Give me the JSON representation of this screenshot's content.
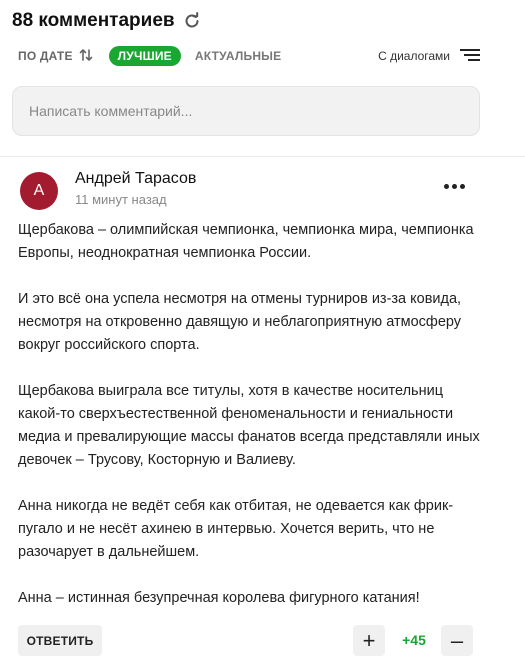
{
  "header": {
    "title": "88 комментариев"
  },
  "filters": {
    "sort_date": "ПО ДАТЕ",
    "best": "ЛУЧШИЕ",
    "actual": "АКТУАЛЬНЫЕ",
    "dialogs": "С диалогами"
  },
  "input": {
    "placeholder": "Написать комментарий..."
  },
  "comment": {
    "avatar_letter": "А",
    "author": "Андрей Тарасов",
    "time": "11 минут назад",
    "paragraphs": [
      "Щербакова – олимпийская чемпионка, чемпионка мира, чемпионка Европы, неоднократная чемпионка России.",
      "И это всё она успела несмотря на отмены турниров из-за ковида, несмотря на откровенно давящую и неблагоприятную атмосферу вокруг российского спорта.",
      "Щербакова выиграла все титулы, хотя в качестве носительниц какой-то сверхъестественной феноменальности и гениальности медиа и превалирующие массы фанатов всегда представляли иных девочек – Трусову, Косторную и Валиеву.",
      "Анна никогда не ведёт себя как отбитая, не одевается как фрик-пугало и не несёт ахинею в интервью. Хочется верить, что не разочарует в дальнейшем.",
      "Анна – истинная безупречная королева фигурного катания!"
    ],
    "reply_label": "ОТВЕТИТЬ",
    "score": "+45",
    "plus_label": "+",
    "minus_label": "–"
  },
  "colors": {
    "accent_green": "#1aa731",
    "avatar_bg": "#a31b2f"
  },
  "icons": [
    "refresh-icon",
    "sort-arrows-icon",
    "menu-lines-icon",
    "more-dots-icon"
  ]
}
